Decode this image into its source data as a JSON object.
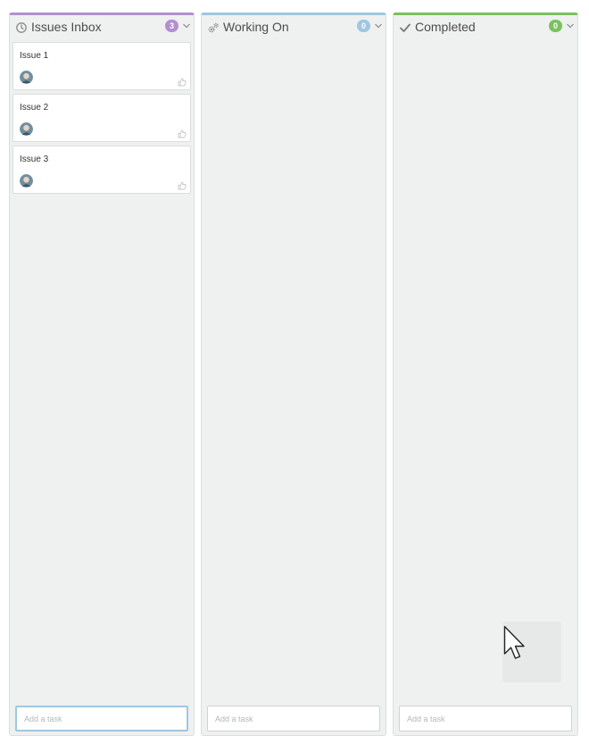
{
  "colors": {
    "inbox_accent": "#b38fd1",
    "working_accent": "#9ec7e2",
    "completed_accent": "#7ac25c",
    "column_bg": "#eff0f0"
  },
  "columns": [
    {
      "title": "Issues Inbox",
      "icon": "clock-icon",
      "count": "3",
      "cards": [
        {
          "title": "Issue 1"
        },
        {
          "title": "Issue 2"
        },
        {
          "title": "Issue 3"
        }
      ],
      "add_placeholder": "Add a task"
    },
    {
      "title": "Working On",
      "icon": "gears-icon",
      "count": "0",
      "cards": [],
      "add_placeholder": "Add a task"
    },
    {
      "title": "Completed",
      "icon": "checkmark-icon",
      "count": "0",
      "cards": [],
      "add_placeholder": "Add a task"
    }
  ]
}
